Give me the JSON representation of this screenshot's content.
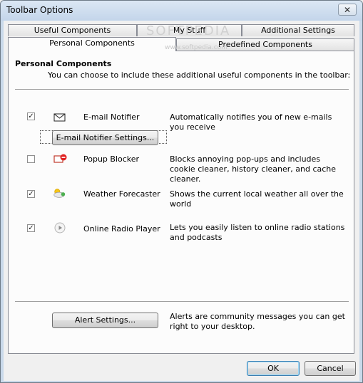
{
  "window": {
    "title": "Toolbar Options"
  },
  "watermark": {
    "text": "SOFTPEDIA",
    "sub": "www.softpedia.com"
  },
  "tabs_back": [
    {
      "label": "Useful Components"
    },
    {
      "label": "My Stuff"
    },
    {
      "label": "Additional Settings"
    }
  ],
  "tabs_front": [
    {
      "label": "Personal Components",
      "active": true
    },
    {
      "label": "Predefined Components",
      "active": false
    }
  ],
  "panel": {
    "title": "Personal Components",
    "description": "You can choose to include these additional useful components in the toolbar:"
  },
  "components": [
    {
      "name": "E-mail Notifier",
      "checked": true,
      "icon": "envelope-icon",
      "description": "Automatically notifies you of new e-mails you receive",
      "settings_button": "E-mail Notifier Settings..."
    },
    {
      "name": "Popup Blocker",
      "checked": false,
      "icon": "popup-blocker-icon",
      "description": "Blocks annoying pop-ups and includes cookie cleaner, history cleaner, and cache cleaner."
    },
    {
      "name": "Weather Forecaster",
      "checked": true,
      "icon": "weather-icon",
      "description": "Shows the current local weather all over the world"
    },
    {
      "name": "Online Radio Player",
      "checked": true,
      "icon": "play-icon",
      "description": "Lets you easily listen to online radio stations and podcasts"
    }
  ],
  "alert": {
    "button": "Alert Settings...",
    "description": "Alerts are community messages you can get right to your desktop."
  },
  "footer": {
    "ok": "OK",
    "cancel": "Cancel"
  },
  "check_glyph": "✓",
  "close_glyph": "✕"
}
